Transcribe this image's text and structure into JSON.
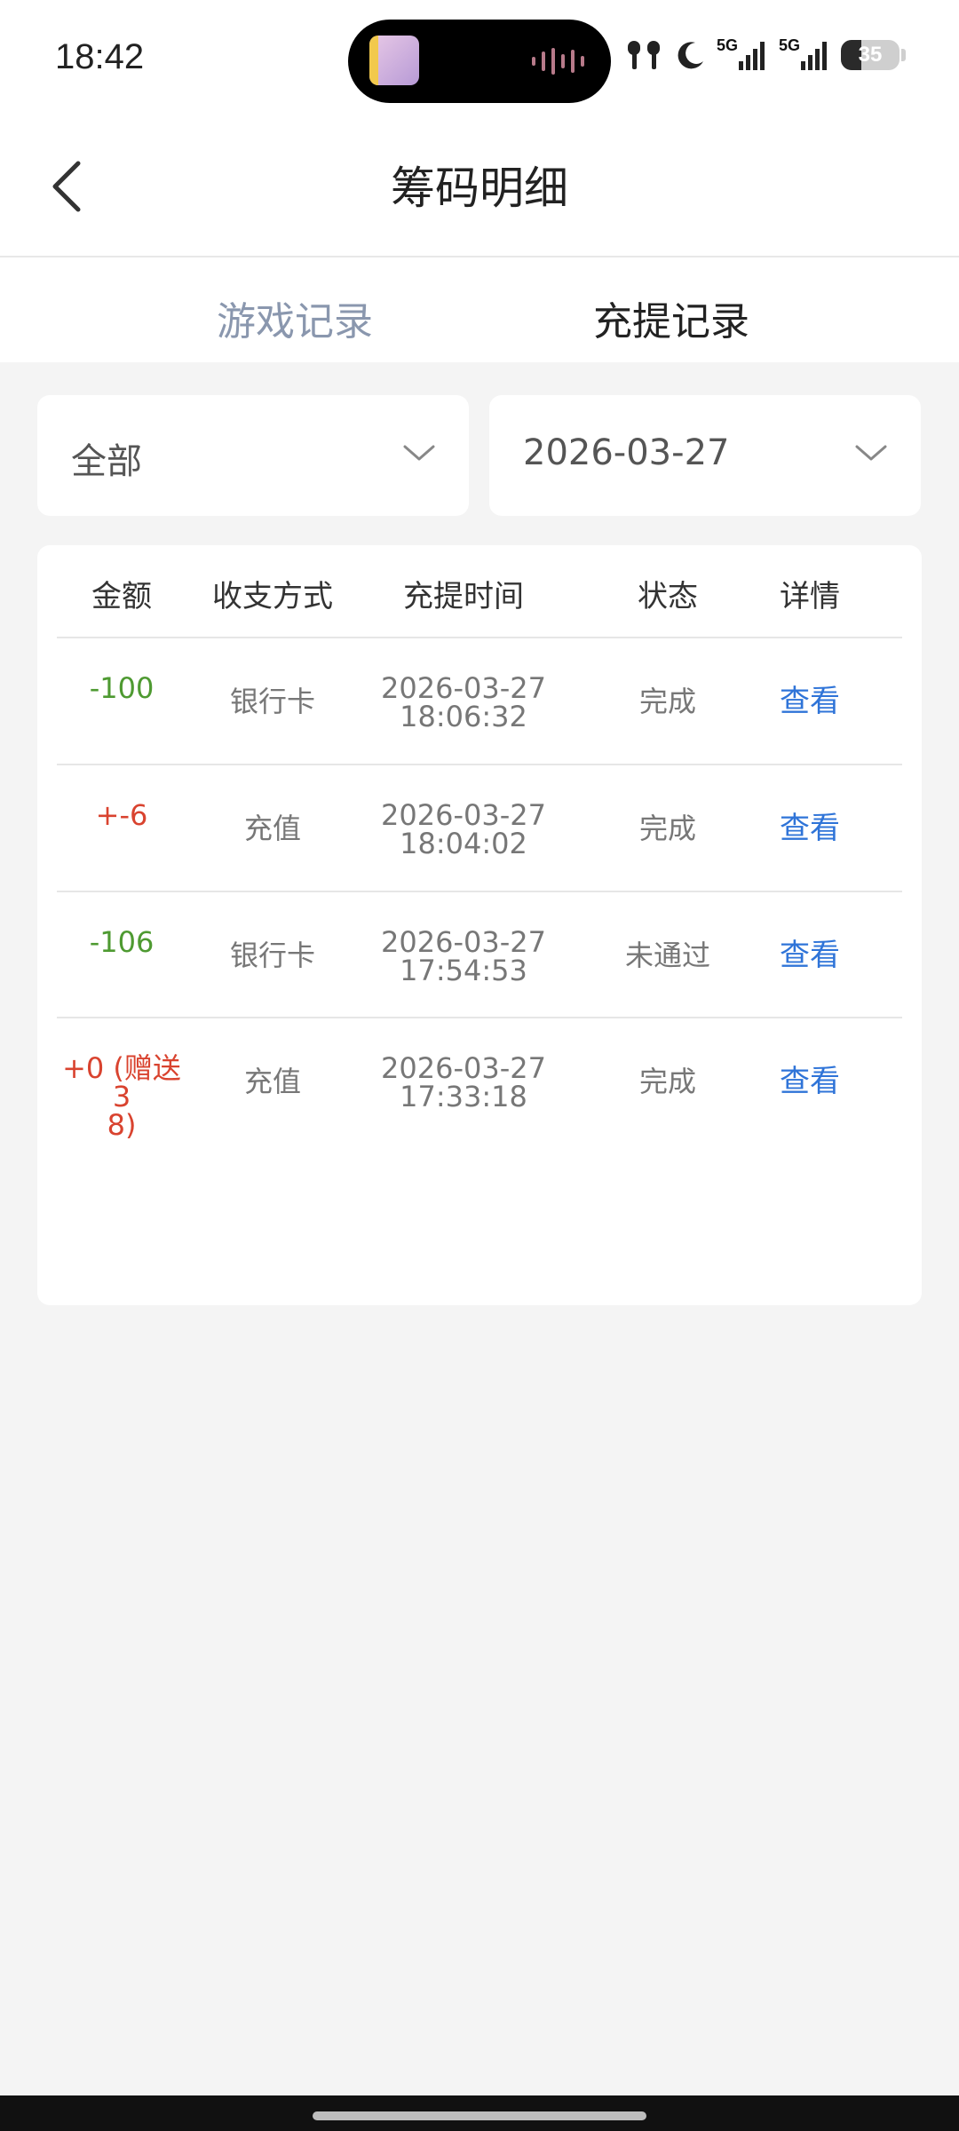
{
  "status_bar": {
    "time": "18:42",
    "network_1": "5G",
    "network_2": "5G",
    "battery": "35",
    "battery_level": 0.35,
    "icons": [
      "earbuds-icon",
      "moon-icon",
      "signal-icon",
      "signal-icon",
      "battery-icon"
    ]
  },
  "header": {
    "title": "筹码明细",
    "back_icon": "chevron-left-icon"
  },
  "tabs": [
    {
      "label": "游戏记录",
      "active": false
    },
    {
      "label": "充提记录",
      "active": true
    }
  ],
  "filters": {
    "type": {
      "value": "全部",
      "icon": "chevron-down-icon"
    },
    "date": {
      "value": "2026-03-27",
      "icon": "chevron-down-icon"
    }
  },
  "table": {
    "columns": [
      "金额",
      "收支方式",
      "充提时间",
      "状态",
      "详情"
    ],
    "rows": [
      {
        "amount_line1": "-100",
        "amount_line2": "",
        "amount_color": "#4e9a31",
        "method": "银行卡",
        "date": "2026-03-27",
        "time": "18:06:32",
        "status": "完成",
        "action": "查看"
      },
      {
        "amount_line1": "+-6",
        "amount_line2": "",
        "amount_color": "#d9432f",
        "method": "充值",
        "date": "2026-03-27",
        "time": "18:04:02",
        "status": "完成",
        "action": "查看"
      },
      {
        "amount_line1": "-106",
        "amount_line2": "",
        "amount_color": "#4e9a31",
        "method": "银行卡",
        "date": "2026-03-27",
        "time": "17:54:53",
        "status": "未通过",
        "action": "查看"
      },
      {
        "amount_line1": "+0 (赠送3",
        "amount_line2": "8)",
        "amount_color": "#d9432f",
        "method": "充值",
        "date": "2026-03-27",
        "time": "17:33:18",
        "status": "完成",
        "action": "查看"
      }
    ]
  }
}
